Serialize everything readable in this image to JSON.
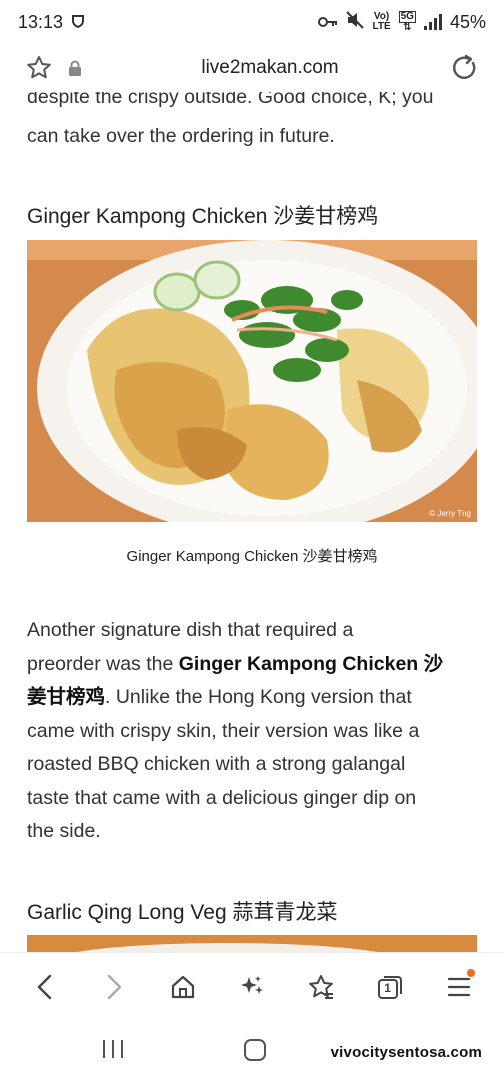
{
  "status": {
    "time": "13:13",
    "network_top": "Vo)",
    "network_bottom": "LTE",
    "gen": "5G",
    "battery": "45%"
  },
  "browser": {
    "url": "live2makan.com"
  },
  "article": {
    "intro_line1": "despite the crispy outside. Good choice, K; you",
    "intro_line2": "can take over the ordering in future.",
    "heading1": "Ginger Kampong Chicken 沙姜甘榜鸡",
    "photo_credit": "© Jerry Tng",
    "caption1": "Ginger Kampong Chicken 沙姜甘榜鸡",
    "p2_line1": "Another signature dish that required a",
    "p2_line2_pre": "preorder was the ",
    "p2_line2_bold": "Ginger Kampong Chicken 沙",
    "p2_line3_bold": "姜甘榜鸡",
    "p2_line3_post": ". Unlike the Hong Kong version that",
    "p2_line4": "came with crispy skin, their version was like a",
    "p2_line5": "roasted BBQ chicken with a strong galangal",
    "p2_line6": "taste that came with a delicious ginger dip on",
    "p2_line7": "the side.",
    "heading2": "Garlic Qing Long Veg 蒜茸青龙菜"
  },
  "tabs": {
    "count": "1"
  },
  "watermark": "vivocitysentosa.com",
  "colors": {
    "accent_dot": "#f26b1d",
    "plate": "#f4f1ea",
    "table": "#d98a4a"
  }
}
